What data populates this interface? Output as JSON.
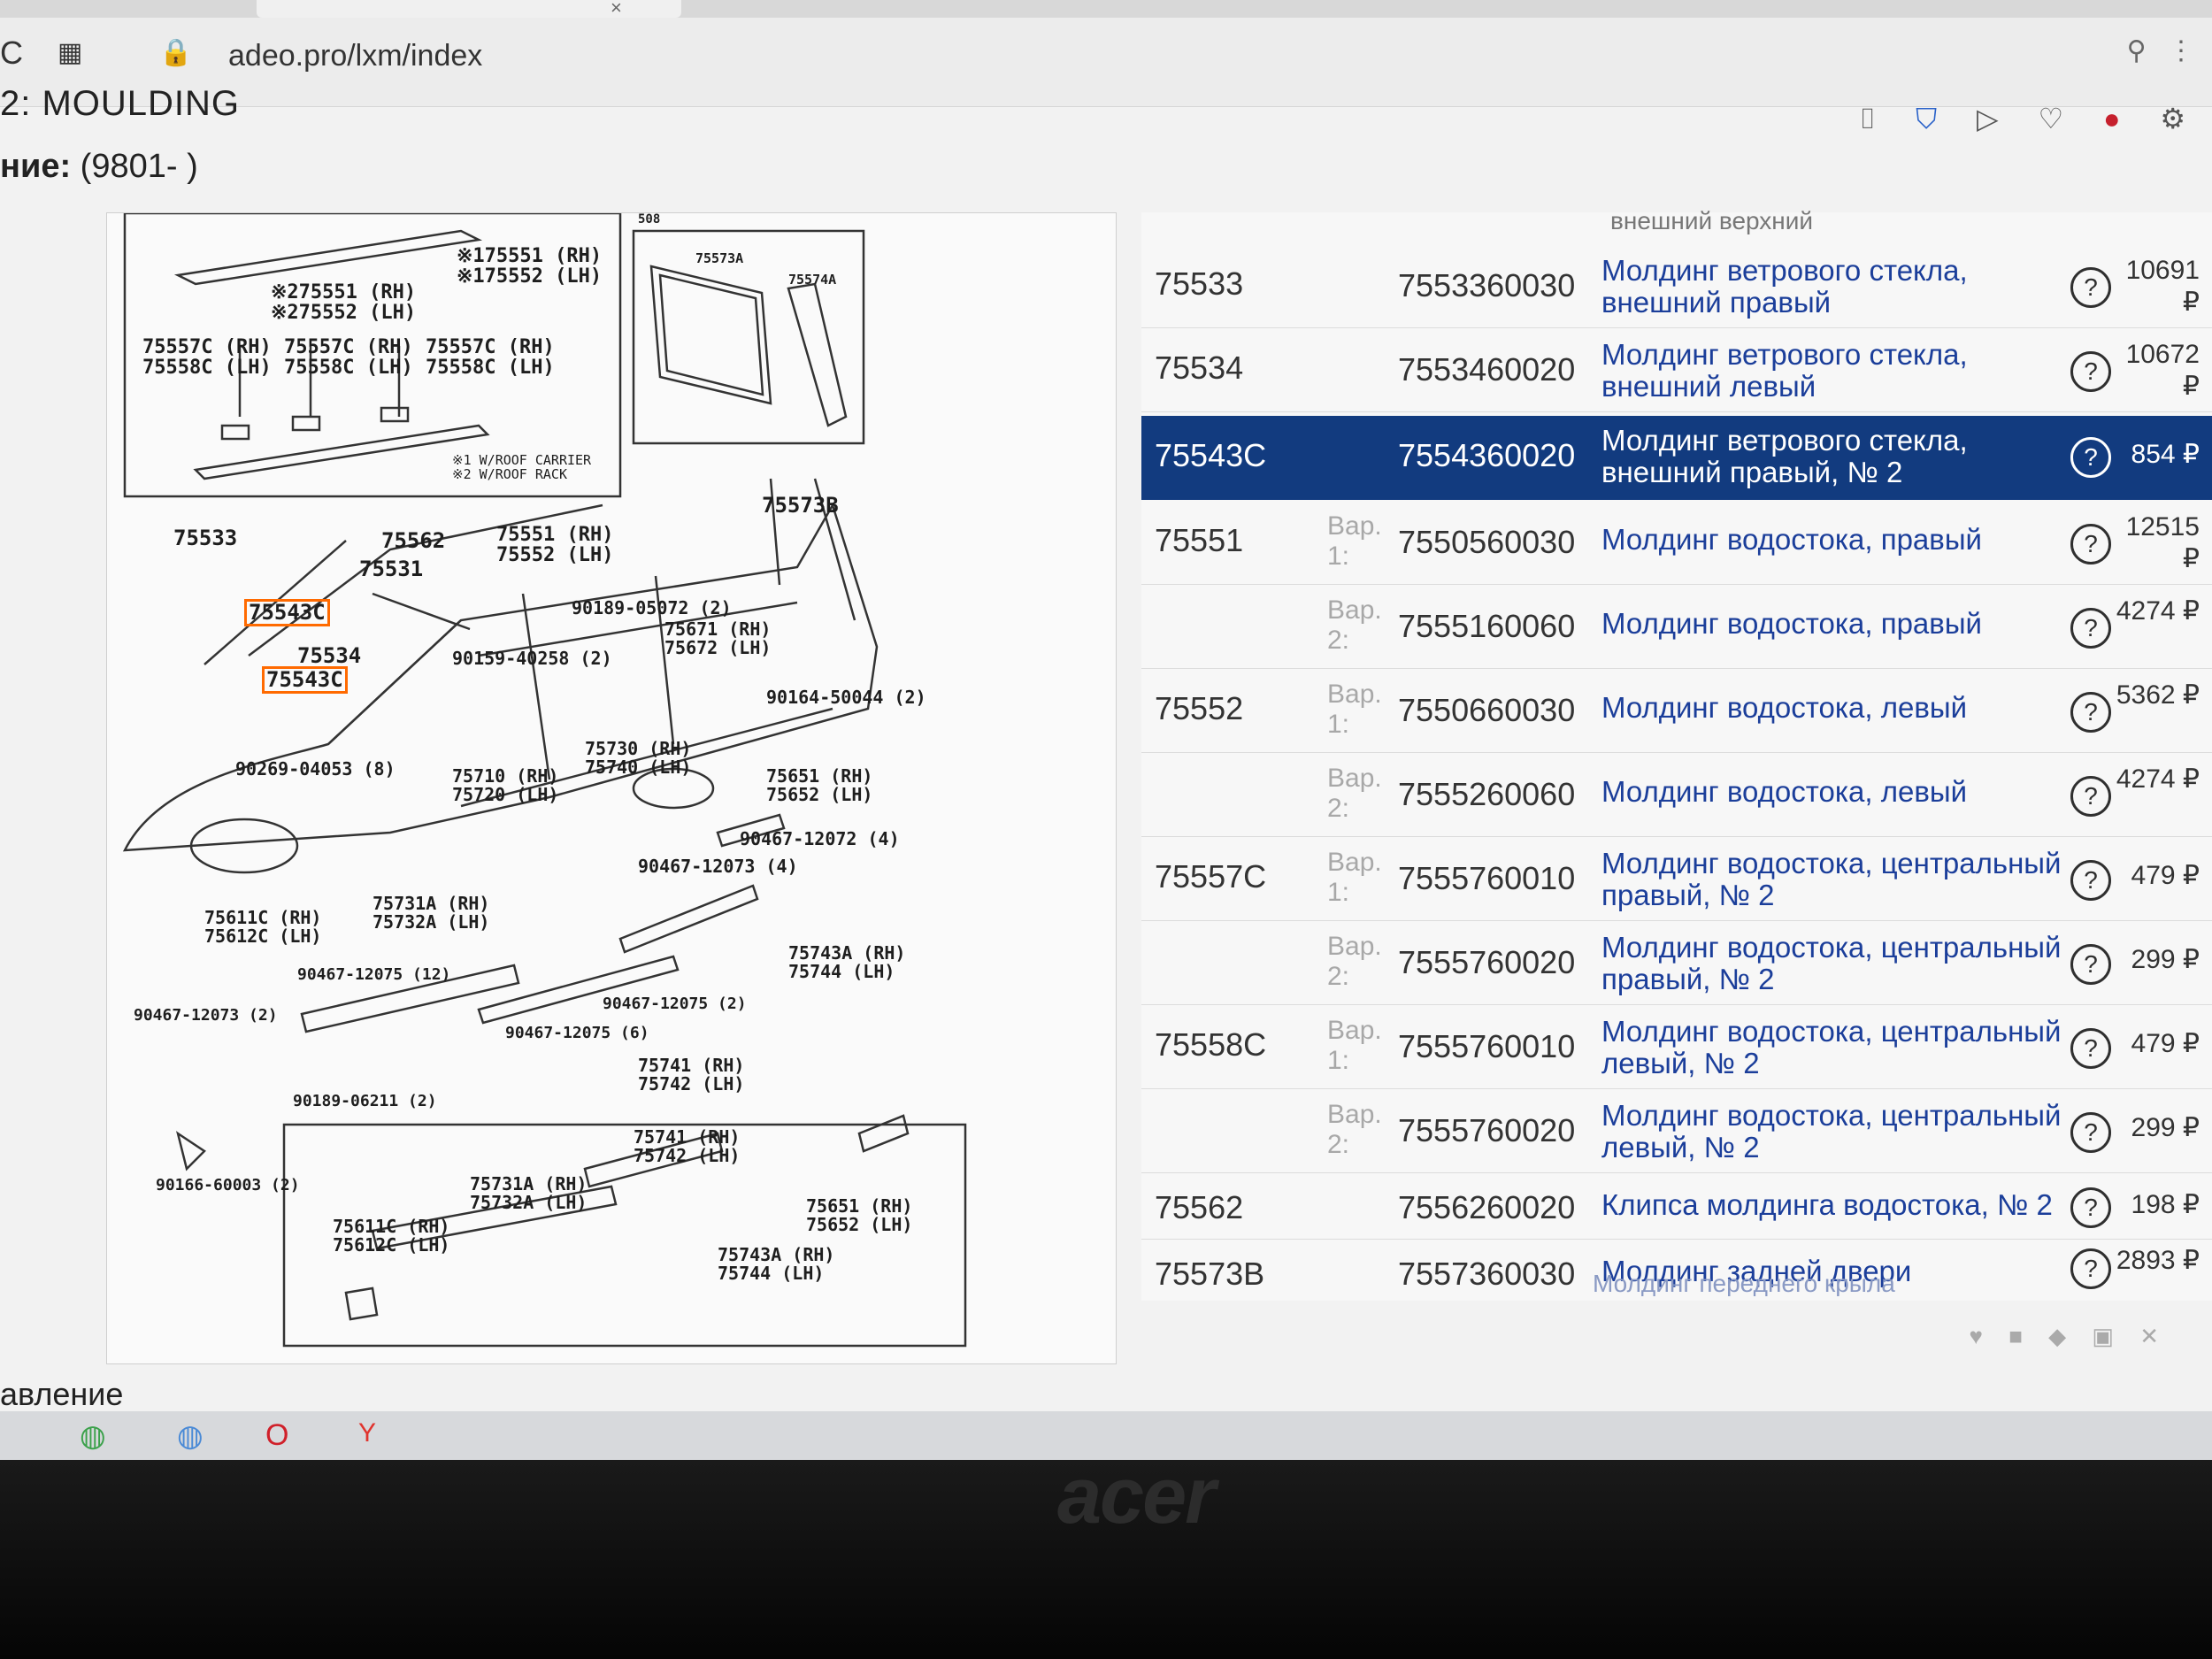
{
  "browser": {
    "url": "adeo.pro/lxm/index",
    "refresh_icon": "refresh-icon",
    "apps_icon": "apps-grid-icon",
    "lock_icon": "lock-icon",
    "search_icon": "search-icon",
    "menu_icon": "more-icon",
    "close_tab": "×"
  },
  "page": {
    "title": "2: MOULDING",
    "subtitle_label": "ние:",
    "subtitle_value": " (9801- )",
    "toolbar": [
      "camera-icon",
      "shield-icon",
      "play-icon",
      "heart-icon",
      "opera-icon",
      "settings-icon"
    ]
  },
  "diagram": {
    "labels": [
      {
        "text": "※175551 (RH)\n※175552 (LH)"
      },
      {
        "text": "※275551 (RH)\n※275552 (LH)"
      },
      {
        "text": "75557C (RH)\n75558C (LH)"
      },
      {
        "text": "75557C (RH)\n75558C (LH)"
      },
      {
        "text": "75557C (RH)\n75558C (LH)"
      },
      {
        "text": "※1 W/ROOF CARRIER\n※2 W/ROOF RACK"
      },
      {
        "text": "508"
      },
      {
        "text": "75573A"
      },
      {
        "text": "75574A"
      },
      {
        "text": "75573B"
      },
      {
        "text": "75533"
      },
      {
        "text": "75562"
      },
      {
        "text": "75531"
      },
      {
        "text": "75551 (RH)\n75552 (LH)"
      },
      {
        "text": "75543C",
        "highlight": true
      },
      {
        "text": "75534"
      },
      {
        "text": "75543C",
        "highlight": true
      },
      {
        "text": "90189-05072 (2)"
      },
      {
        "text": "75671 (RH)\n75672 (LH)"
      },
      {
        "text": "90159-40258 (2)"
      },
      {
        "text": "90164-50044 (2)"
      },
      {
        "text": "90269-04053 (8)"
      },
      {
        "text": "75710 (RH)\n75720 (LH)"
      },
      {
        "text": "75730 (RH)\n75740 (LH)"
      },
      {
        "text": "75651 (RH)\n75652 (LH)"
      },
      {
        "text": "90467-12072 (4)"
      },
      {
        "text": "90467-12073 (4)"
      },
      {
        "text": "75611C (RH)\n75612C (LH)"
      },
      {
        "text": "75731A (RH)\n75732A (LH)"
      },
      {
        "text": "90467-12075 (12)"
      },
      {
        "text": "75743A (RH)\n75744 (LH)"
      },
      {
        "text": "90467-12073 (2)"
      },
      {
        "text": "90467-12075 (2)"
      },
      {
        "text": "90467-12075 (6)"
      },
      {
        "text": "75741 (RH)\n75742 (LH)"
      },
      {
        "text": "90189-06211 (2)"
      },
      {
        "text": "75741 (RH)\n75742 (LH)"
      },
      {
        "text": "90166-60003 (2)"
      },
      {
        "text": "75731A (RH)\n75732A (LH)"
      },
      {
        "text": "75651 (RH)\n75652 (LH)"
      },
      {
        "text": "75611C (RH)\n75612C (LH)"
      },
      {
        "text": "75743A (RH)\n75744 (LH)"
      }
    ]
  },
  "parts": {
    "top_partial": "внешний верхний",
    "bottom_partial": "Молдинг переднего крыла",
    "rows": [
      {
        "code": "75533",
        "variant": "",
        "number": "7553360030",
        "name": "Молдинг ветрового стекла, внешний правый",
        "price": "10691 ₽",
        "selected": false
      },
      {
        "code": "75534",
        "variant": "",
        "number": "7553460020",
        "name": "Молдинг ветрового стекла, внешний левый",
        "price": "10672 ₽",
        "selected": false
      },
      {
        "code": "75543C",
        "variant": "",
        "number": "7554360020",
        "name": "Молдинг ветрового стекла, внешний правый, № 2",
        "price": "854 ₽",
        "selected": true
      },
      {
        "code": "75551",
        "variant": "Вар. 1:",
        "number": "7550560030",
        "name": "Молдинг водостока, правый",
        "price": "12515 ₽",
        "selected": false
      },
      {
        "code": "",
        "variant": "Вар. 2:",
        "number": "7555160060",
        "name": "Молдинг водостока, правый",
        "price": "4274 ₽",
        "selected": false
      },
      {
        "code": "75552",
        "variant": "Вар. 1:",
        "number": "7550660030",
        "name": "Молдинг водостока, левый",
        "price": "5362 ₽",
        "selected": false
      },
      {
        "code": "",
        "variant": "Вар. 2:",
        "number": "7555260060",
        "name": "Молдинг водостока, левый",
        "price": "4274 ₽",
        "selected": false
      },
      {
        "code": "75557C",
        "variant": "Вар. 1:",
        "number": "7555760010",
        "name": "Молдинг водостока, центральный правый, № 2",
        "price": "479 ₽",
        "selected": false
      },
      {
        "code": "",
        "variant": "Вар. 2:",
        "number": "7555760020",
        "name": "Молдинг водостока, центральный правый, № 2",
        "price": "299 ₽",
        "selected": false
      },
      {
        "code": "75558C",
        "variant": "Вар. 1:",
        "number": "7555760010",
        "name": "Молдинг водостока, центральный левый, № 2",
        "price": "479 ₽",
        "selected": false
      },
      {
        "code": "",
        "variant": "Вар. 2:",
        "number": "7555760020",
        "name": "Молдинг водостока, центральный левый, № 2",
        "price": "299 ₽",
        "selected": false
      },
      {
        "code": "75562",
        "variant": "",
        "number": "7556260020",
        "name": "Клипса молдинга водостока, № 2",
        "price": "198 ₽",
        "selected": false
      },
      {
        "code": "75573B",
        "variant": "",
        "number": "7557360030",
        "name": "Молдинг задней двери",
        "price": "2893 ₽",
        "selected": false
      }
    ]
  },
  "footer": {
    "text": "авление"
  },
  "laptop": {
    "brand": "acer"
  }
}
